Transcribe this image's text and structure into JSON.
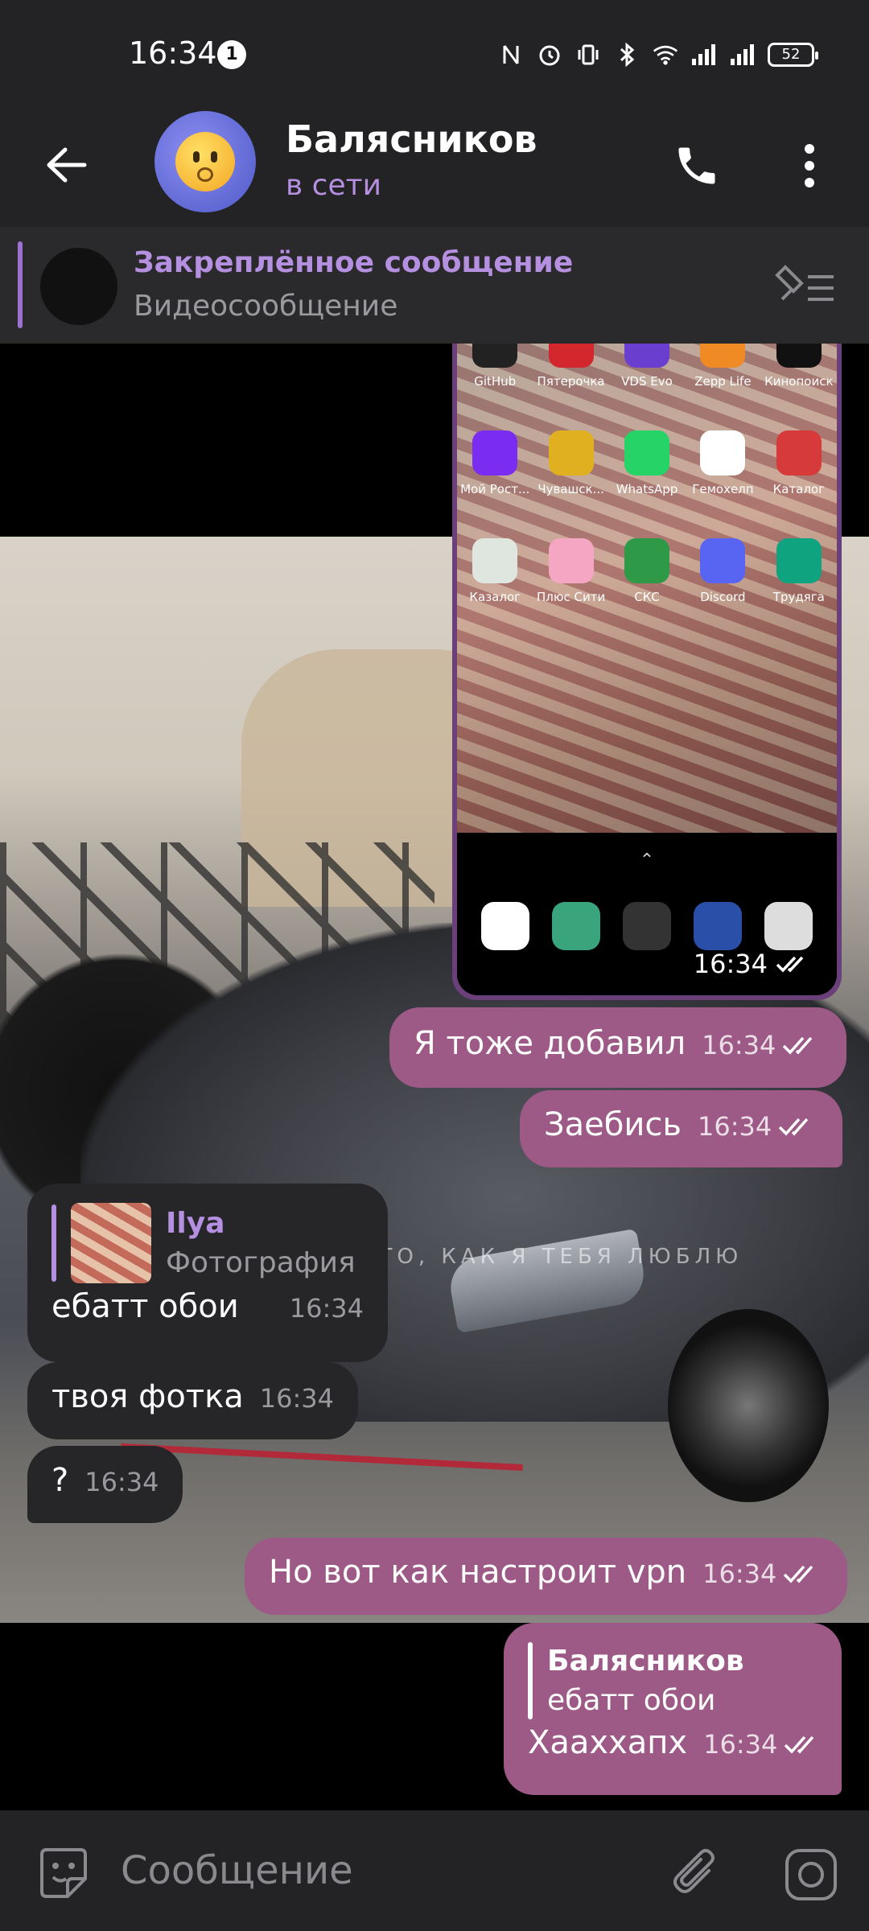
{
  "status_bar": {
    "time": "16:34",
    "notification_count": "1",
    "battery": "52"
  },
  "header": {
    "name": "Балясников",
    "status": "в сети"
  },
  "pinned": {
    "title": "Закреплённое сообщение",
    "subtitle": "Видеосообщение"
  },
  "media_message": {
    "apps": [
      {
        "label": "GitHub",
        "color": "#222222"
      },
      {
        "label": "Пятерочка",
        "color": "#d2272c"
      },
      {
        "label": "VDS Evo",
        "color": "#6a3fd0"
      },
      {
        "label": "Zepp Life",
        "color": "#f08a24"
      },
      {
        "label": "Кинопоиск",
        "color": "#111111"
      },
      {
        "label": "Мой Рост...",
        "color": "#7a2cf0"
      },
      {
        "label": "Чувашск...",
        "color": "#e0b020"
      },
      {
        "label": "WhatsApp",
        "color": "#25d366"
      },
      {
        "label": "Гемохелп",
        "color": "#ffffff"
      },
      {
        "label": "Каталог",
        "color": "#d63a3a"
      },
      {
        "label": "Казалог",
        "color": "#dfe6e0"
      },
      {
        "label": "Плюс Сити",
        "color": "#f4a6c2"
      },
      {
        "label": "СКС",
        "color": "#2e9a48"
      },
      {
        "label": "Discord",
        "color": "#5865f2"
      },
      {
        "label": "Трудяга",
        "color": "#10a37f"
      }
    ],
    "dock": [
      {
        "name": "messages-app-icon",
        "color": "#ffffff"
      },
      {
        "name": "phone-app-icon",
        "color": "#3aa57c"
      },
      {
        "name": "folder-app-icon",
        "color": "#333333"
      },
      {
        "name": "gallery-app-icon",
        "color": "#2a4fa8"
      },
      {
        "name": "camera-app-icon",
        "color": "#dddddd"
      }
    ],
    "time": "16:34"
  },
  "wallpaper_text": "Я ТЕБЕ ПОЮ ПРО ТО, КАК Я ТЕБЯ ЛЮБЛЮ",
  "messages": [
    {
      "text": "Я тоже добавил",
      "time": "16:34"
    },
    {
      "text": "Заебись",
      "time": "16:34"
    },
    {
      "reply_author": "Ilya",
      "reply_text": "Фотография",
      "text": "ебатт обои",
      "time": "16:34"
    },
    {
      "text": "твоя фотка",
      "time": "16:34"
    },
    {
      "text": "?",
      "time": "16:34"
    },
    {
      "text": "Но вот как настроит vpn",
      "time": "16:34"
    },
    {
      "reply_author": "Балясников",
      "reply_text": "ебатт обои",
      "text": "Хааххапх",
      "time": "16:34"
    }
  ],
  "composer": {
    "placeholder": "Сообщение"
  },
  "colors": {
    "outgoing": "#9d5a86",
    "incoming": "#262629",
    "accent": "#b58fe0"
  }
}
